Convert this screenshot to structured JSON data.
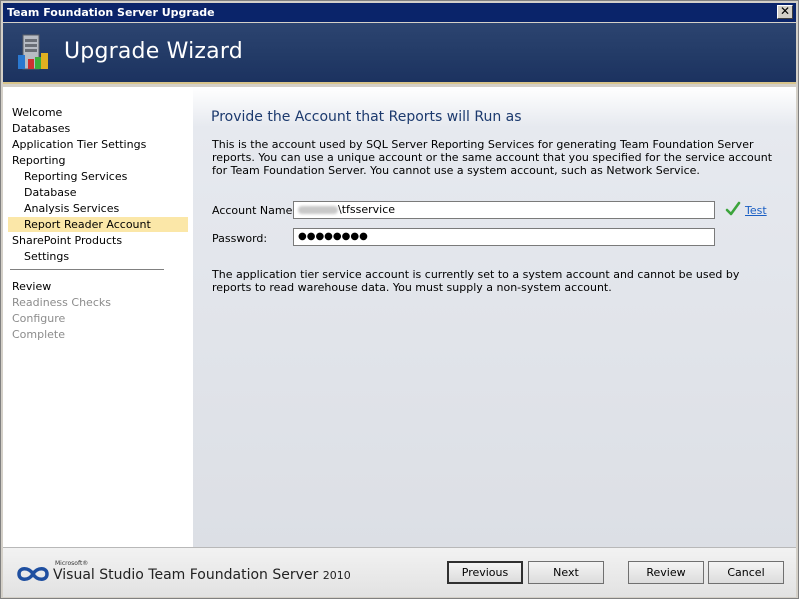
{
  "window": {
    "title": "Team Foundation Server Upgrade",
    "close_glyph": "✕"
  },
  "banner": {
    "title": "Upgrade Wizard",
    "icon": "server-wizard-icon"
  },
  "sidebar": {
    "items": [
      {
        "label": "Welcome",
        "level": 0,
        "state": "normal"
      },
      {
        "label": "Databases",
        "level": 0,
        "state": "normal"
      },
      {
        "label": "Application Tier Settings",
        "level": 0,
        "state": "normal"
      },
      {
        "label": "Reporting",
        "level": 0,
        "state": "normal"
      },
      {
        "label": "Reporting Services",
        "level": 1,
        "state": "normal"
      },
      {
        "label": "Database",
        "level": 1,
        "state": "normal"
      },
      {
        "label": "Analysis Services",
        "level": 1,
        "state": "normal"
      },
      {
        "label": "Report Reader Account",
        "level": 1,
        "state": "selected"
      },
      {
        "label": "SharePoint Products",
        "level": 0,
        "state": "normal"
      },
      {
        "label": "Settings",
        "level": 1,
        "state": "normal"
      },
      {
        "label": "Review",
        "level": 0,
        "state": "normal"
      },
      {
        "label": "Readiness Checks",
        "level": 0,
        "state": "disabled"
      },
      {
        "label": "Configure",
        "level": 0,
        "state": "disabled"
      },
      {
        "label": "Complete",
        "level": 0,
        "state": "disabled"
      }
    ]
  },
  "main": {
    "title": "Provide the Account that Reports will Run as",
    "description": "This is the account used by SQL Server Reporting Services for generating Team Foundation Server reports. You can use a unique account or the same account that you specified for the service account for Team Foundation Server. You cannot use a system account, such as Network Service.",
    "account_name_label": "Account Name:",
    "account_name_value": "\\tfsservice",
    "password_label": "Password:",
    "password_value": "●●●●●●●●",
    "test_link": "Test",
    "note": "The application tier service account is currently set to a system account and cannot be used by reports to read warehouse data. You must supply a non-system account."
  },
  "footer": {
    "logo_microsoft": "Microsoft®",
    "logo_text": "Visual Studio",
    "logo_product": " Team Foundation Server ",
    "logo_year": "2010",
    "buttons": {
      "previous": "Previous",
      "next": "Next",
      "review": "Review",
      "cancel": "Cancel"
    }
  },
  "colors": {
    "banner": "#223a66",
    "selected_nav": "#fbe7a8",
    "check": "#3ca43c",
    "link": "#1a5fc4"
  }
}
